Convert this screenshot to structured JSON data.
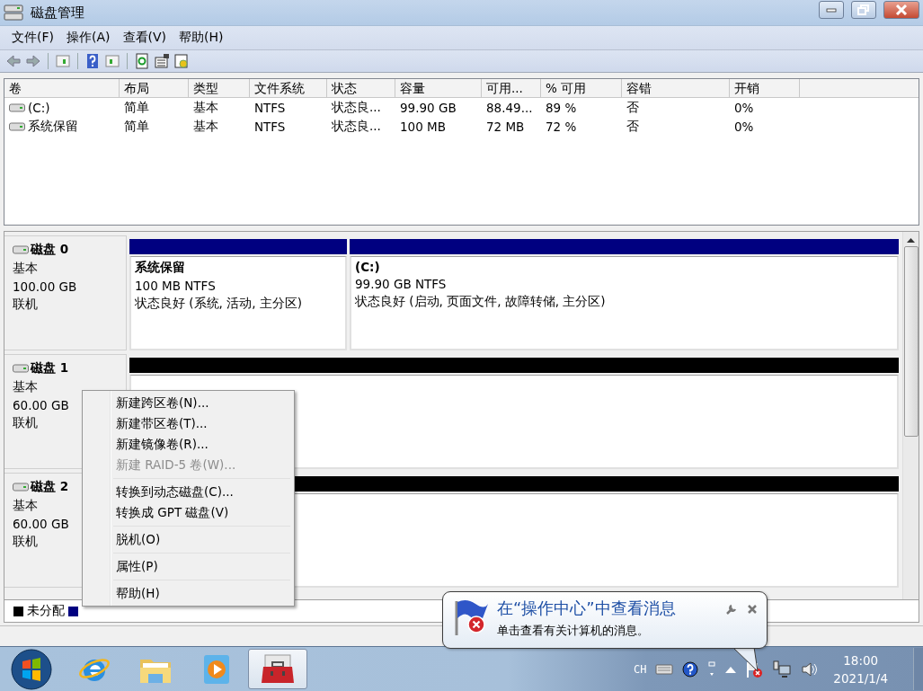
{
  "window": {
    "title": "磁盘管理"
  },
  "menu": [
    "文件(F)",
    "操作(A)",
    "查看(V)",
    "帮助(H)"
  ],
  "volumes": {
    "columns": [
      "卷",
      "布局",
      "类型",
      "文件系统",
      "状态",
      "容量",
      "可用...",
      "% 可用",
      "容错",
      "开销"
    ],
    "rows": [
      {
        "cells": [
          "(C:)",
          "简单",
          "基本",
          "NTFS",
          "状态良...",
          "99.90 GB",
          "88.49...",
          "89 %",
          "否",
          "0%"
        ]
      },
      {
        "cells": [
          "系统保留",
          "简单",
          "基本",
          "NTFS",
          "状态良...",
          "100 MB",
          "72 MB",
          "72 %",
          "否",
          "0%"
        ]
      }
    ]
  },
  "disks": [
    {
      "name": "磁盘 0",
      "type": "基本",
      "size": "100.00 GB",
      "status": "联机",
      "partitions": [
        {
          "kind": "primary",
          "title": "系统保留",
          "detail": "100 MB NTFS",
          "state": "状态良好 (系统, 活动, 主分区)"
        },
        {
          "kind": "primary",
          "title": "(C:)",
          "detail": "99.90 GB NTFS",
          "state": "状态良好 (启动, 页面文件, 故障转储, 主分区)"
        }
      ]
    },
    {
      "name": "磁盘 1",
      "type": "基本",
      "size": "60.00 GB",
      "status": "联机",
      "partitions": [
        {
          "kind": "unallocated"
        }
      ]
    },
    {
      "name": "磁盘 2",
      "type": "基本",
      "size": "60.00 GB",
      "status": "联机",
      "partitions": [
        {
          "kind": "unallocated"
        }
      ]
    }
  ],
  "legend": [
    {
      "label": "未分配",
      "color": "#000000"
    },
    {
      "color": "#000080"
    }
  ],
  "context_menu": [
    [
      {
        "label": "新建跨区卷(N)...",
        "disabled": false
      },
      {
        "label": "新建带区卷(T)...",
        "disabled": false
      },
      {
        "label": "新建镜像卷(R)...",
        "disabled": false
      },
      {
        "label": "新建 RAID-5 卷(W)...",
        "disabled": true
      }
    ],
    [
      {
        "label": "转换到动态磁盘(C)...",
        "disabled": false
      },
      {
        "label": "转换成 GPT 磁盘(V)",
        "disabled": false
      }
    ],
    [
      {
        "label": "脱机(O)",
        "disabled": false
      }
    ],
    [
      {
        "label": "属性(P)",
        "disabled": false
      }
    ],
    [
      {
        "label": "帮助(H)",
        "disabled": false
      }
    ]
  ],
  "notification": {
    "title": "在“操作中心”中查看消息",
    "body": "单击查看有关计算机的消息。"
  },
  "taskbar": {
    "apps": [
      {
        "kind": "browser",
        "selected": false
      },
      {
        "kind": "folder",
        "selected": false
      },
      {
        "kind": "media",
        "selected": false
      },
      {
        "kind": "toolbox",
        "selected": true
      }
    ],
    "language": "CH",
    "time": "18:00",
    "date": "2021/1/4"
  }
}
